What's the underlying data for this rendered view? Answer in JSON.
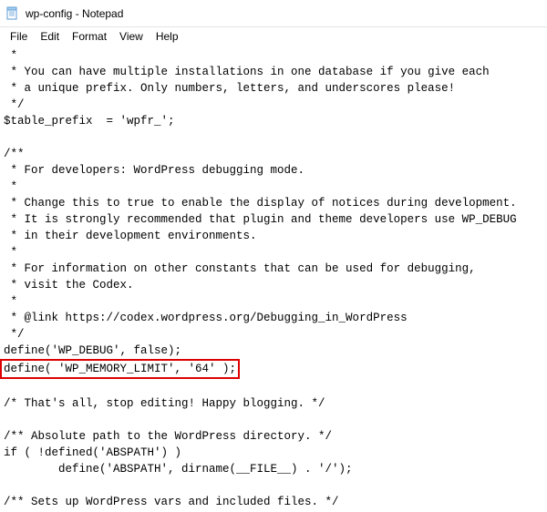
{
  "window": {
    "title": "wp-config - Notepad"
  },
  "menu": {
    "file": "File",
    "edit": "Edit",
    "format": "Format",
    "view": "View",
    "help": "Help"
  },
  "code": {
    "line01": " *",
    "line02": " * You can have multiple installations in one database if you give each",
    "line03": " * a unique prefix. Only numbers, letters, and underscores please!",
    "line04": " */",
    "line05": "$table_prefix  = 'wpfr_';",
    "line06": "",
    "line07": "/**",
    "line08": " * For developers: WordPress debugging mode.",
    "line09": " *",
    "line10": " * Change this to true to enable the display of notices during development.",
    "line11": " * It is strongly recommended that plugin and theme developers use WP_DEBUG",
    "line12": " * in their development environments.",
    "line13": " *",
    "line14": " * For information on other constants that can be used for debugging,",
    "line15": " * visit the Codex.",
    "line16": " *",
    "line17": " * @link https://codex.wordpress.org/Debugging_in_WordPress",
    "line18": " */",
    "line19": "define('WP_DEBUG', false);",
    "line20": "define( 'WP_MEMORY_LIMIT', '64' );",
    "line21": "",
    "line22": "/* That's all, stop editing! Happy blogging. */",
    "line23": "",
    "line24": "/** Absolute path to the WordPress directory. */",
    "line25": "if ( !defined('ABSPATH') )",
    "line26": "        define('ABSPATH', dirname(__FILE__) . '/');",
    "line27": "",
    "line28": "/** Sets up WordPress vars and included files. */"
  }
}
